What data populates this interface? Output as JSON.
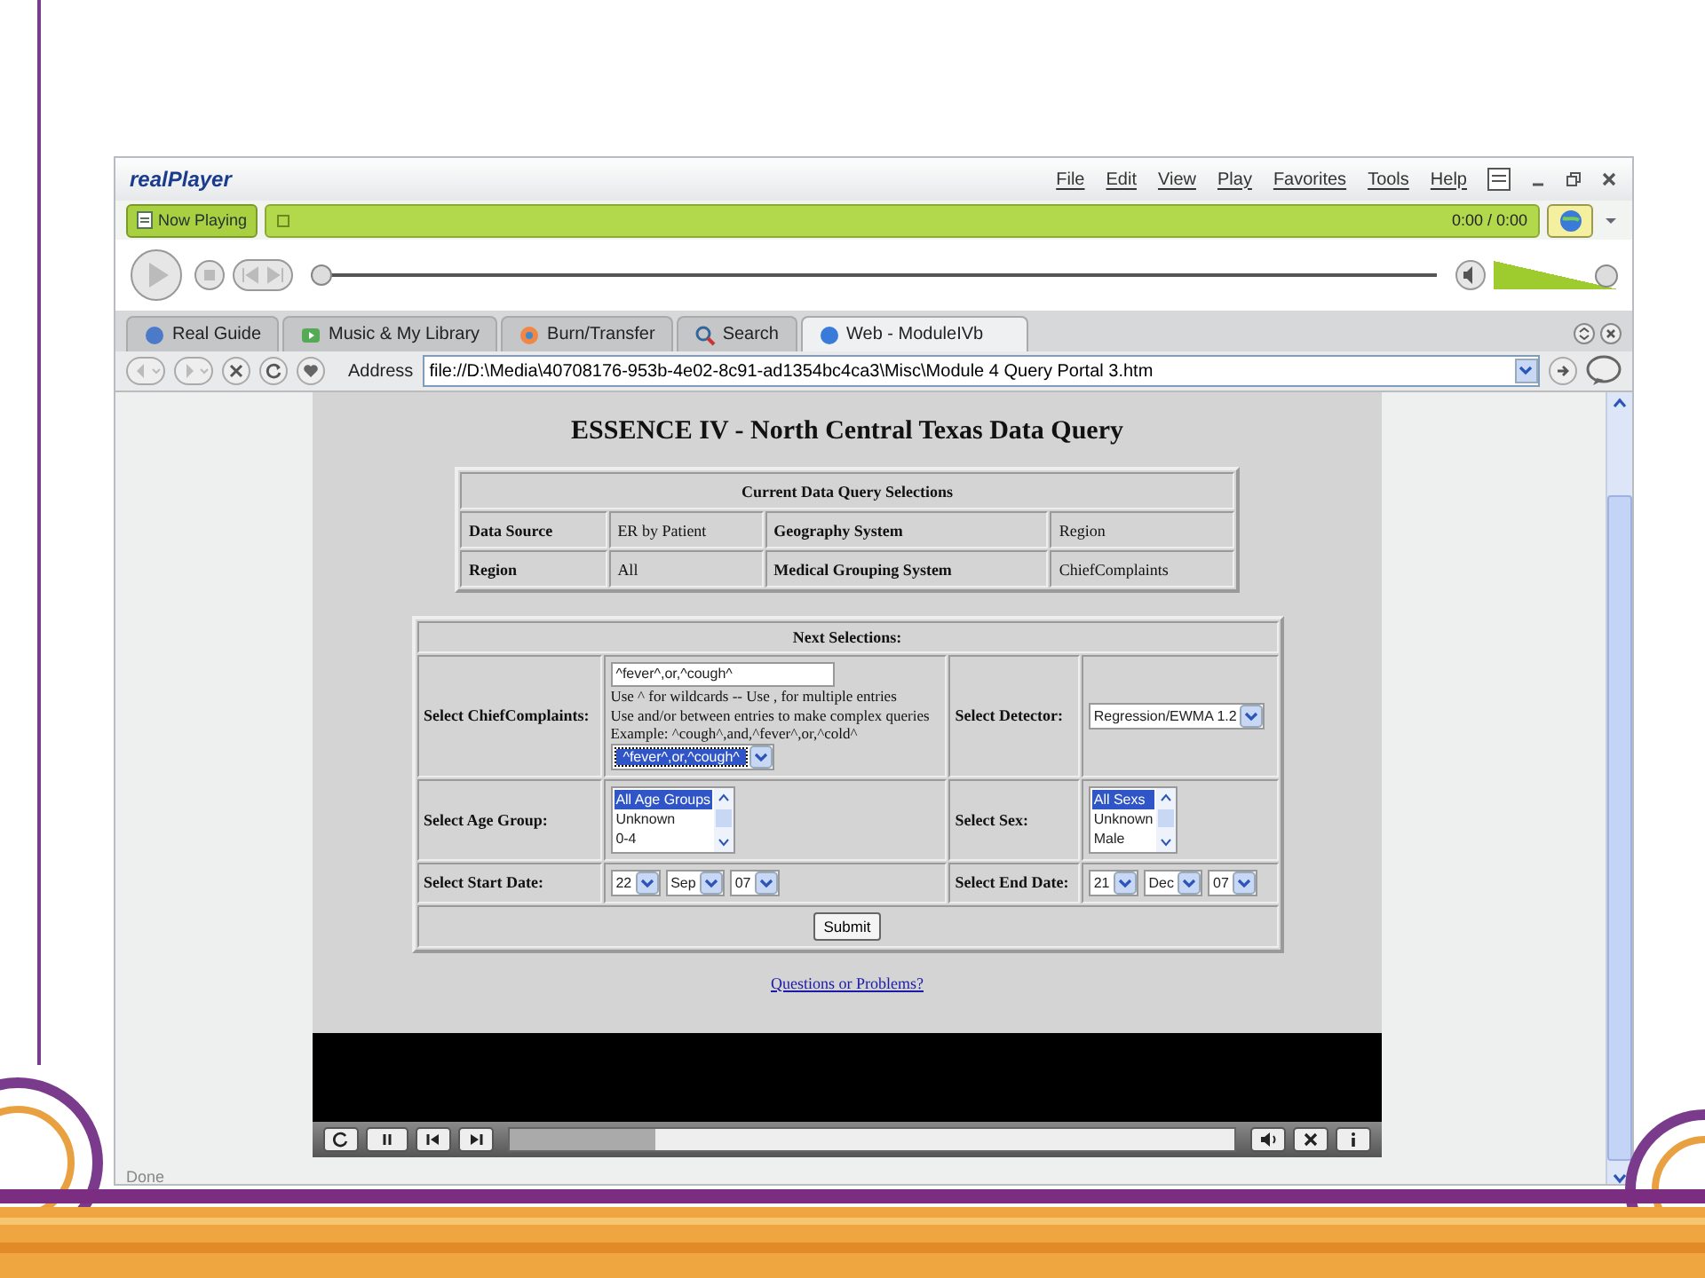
{
  "player": {
    "logo": "realPlayer",
    "menu": [
      "File",
      "Edit",
      "View",
      "Play",
      "Favorites",
      "Tools",
      "Help"
    ],
    "now_playing": "Now Playing",
    "time": "0:00 / 0:00",
    "seek": {
      "level": 0
    },
    "volume": {
      "level": 1
    }
  },
  "tabs": [
    {
      "label": "Real Guide",
      "selected": false
    },
    {
      "label": "Music & My Library",
      "selected": false
    },
    {
      "label": "Burn/Transfer",
      "selected": false
    },
    {
      "label": "Search",
      "selected": false
    },
    {
      "label": "Web - ModuleIVb",
      "selected": true
    }
  ],
  "address": {
    "label": "Address",
    "value": "file://D:\\Media\\40708176-953b-4e02-8c91-ad1354bc4ca3\\Misc\\Module 4 Query Portal 3.htm"
  },
  "page": {
    "title": "ESSENCE IV - North Central Texas Data Query",
    "current": {
      "heading": "Current Data Query Selections",
      "rows": [
        [
          "Data Source",
          "ER by Patient",
          "Geography System",
          "Region"
        ],
        [
          "Region",
          "All",
          "Medical Grouping System",
          "ChiefComplaints"
        ]
      ]
    },
    "next": {
      "heading": "Next Selections:",
      "complaints": {
        "label": "Select ChiefComplaints:",
        "value": "^fever^,or,^cough^",
        "help": [
          "Use ^ for wildcards -- Use , for multiple entries",
          "Use and/or between entries to make complex queries",
          "Example: ^cough^,and,^fever^,or,^cold^"
        ],
        "dropdown": "^fever^,or,^cough^"
      },
      "detector": {
        "label": "Select Detector:",
        "value": "Regression/EWMA 1.2"
      },
      "age": {
        "label": "Select Age Group:",
        "options": [
          {
            "label": "All Age Groups",
            "selected": true
          },
          {
            "label": "Unknown",
            "selected": false
          },
          {
            "label": "0-4",
            "selected": false
          }
        ]
      },
      "sex": {
        "label": "Select Sex:",
        "options": [
          {
            "label": "All Sexs",
            "selected": true
          },
          {
            "label": "Unknown",
            "selected": false
          },
          {
            "label": "Male",
            "selected": false
          }
        ]
      },
      "start": {
        "label": "Select Start Date:",
        "parts": [
          "22",
          "Sep",
          "07"
        ]
      },
      "end": {
        "label": "Select End Date:",
        "parts": [
          "21",
          "Dec",
          "07"
        ]
      },
      "submit": "Submit"
    },
    "link": "Questions or Problems?"
  },
  "video_bar": {
    "level": 0.2
  },
  "status": "Done"
}
